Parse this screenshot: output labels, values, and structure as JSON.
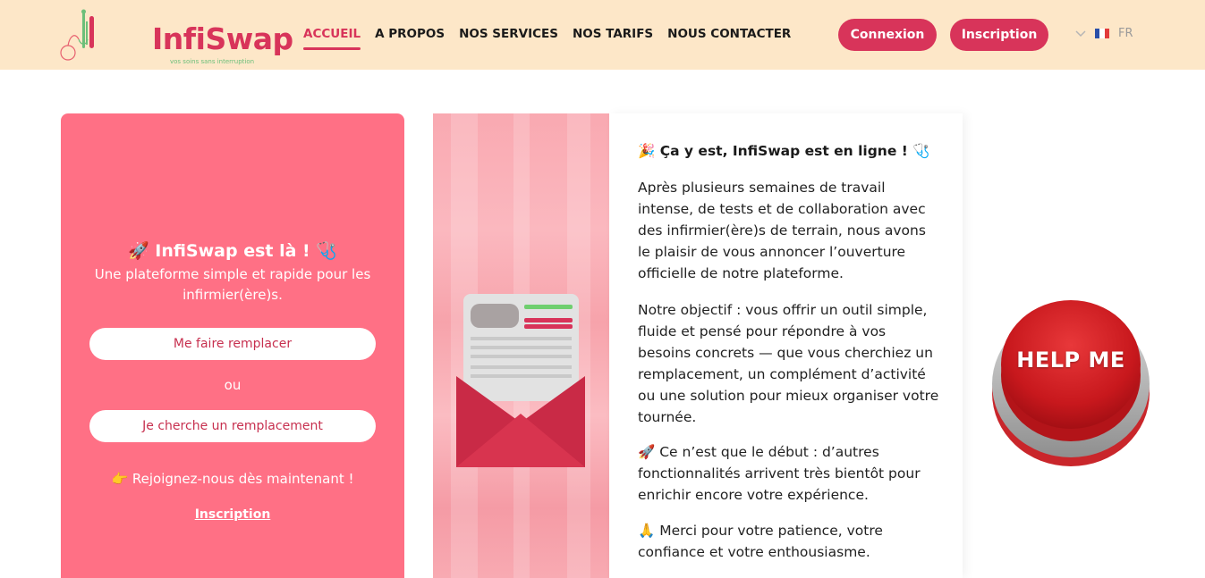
{
  "header": {
    "logo_text": "InfiSwap",
    "logo_tagline": "vos soins sans interruption",
    "nav": [
      {
        "label": "ACCUEIL",
        "active": true
      },
      {
        "label": "A PROPOS",
        "active": false
      },
      {
        "label": "NOS SERVICES",
        "active": false
      },
      {
        "label": "NOS TARIFS",
        "active": false
      },
      {
        "label": "NOUS CONTACTER",
        "active": false
      }
    ],
    "login_label": "Connexion",
    "signup_label": "Inscription",
    "lang_label": "FR"
  },
  "left_card": {
    "title": "🚀 InfiSwap est là ! 🩺",
    "subtitle": "Une plateforme simple et rapide pour les infirmier(ère)s.",
    "button_replace": "Me faire remplacer",
    "or_label": "ou",
    "button_search": "Je cherche un remplacement",
    "join_text": "👉 Rejoignez-nous dès maintenant !",
    "signup_link": "Inscription"
  },
  "announcement": {
    "title": "🎉 Ça y est, InfiSwap est en ligne ! 🩺",
    "p1": "Après plusieurs semaines de travail intense, de tests et de collaboration avec des infirmier(ère)s de terrain, nous avons le plaisir de vous annoncer l’ouverture officielle de notre plateforme.",
    "p2": "Notre objectif : vous offrir un outil simple, fluide et pensé pour répondre à vos besoins concrets — que vous cherchiez un remplacement, un complément d’activité ou une solution pour mieux organiser votre tournée.",
    "p3": "🚀 Ce n’est que le début : d’autres fonctionnalités arrivent très bientôt pour enrichir encore votre expérience.",
    "p4": "🙏 Merci pour votre patience, votre confiance et votre enthousiasme."
  },
  "help_button": {
    "label": "HELP ME"
  },
  "colors": {
    "brand": "#d8345a",
    "header_bg": "#fde7c8",
    "card_pink": "#ff7085"
  }
}
